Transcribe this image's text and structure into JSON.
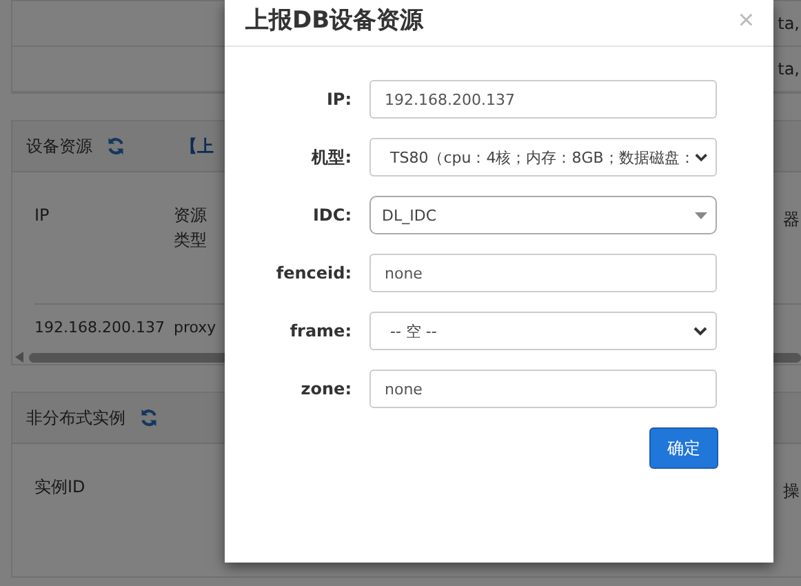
{
  "page": {
    "top_panel": {
      "side_texts": [
        "ta,",
        "ta,"
      ]
    },
    "device_panel": {
      "title": "设备资源",
      "link": "【上",
      "columns": [
        "IP",
        "资源类型"
      ],
      "side_text": "器",
      "rows": [
        [
          "192.168.200.137",
          "proxy"
        ]
      ]
    },
    "instance_panel": {
      "title": "非分布式实例",
      "columns": [
        "实例ID"
      ],
      "side_text": "操"
    }
  },
  "dialog": {
    "title": "上报DB设备资源",
    "close": "×",
    "fields": [
      {
        "label": "IP:",
        "kind": "input",
        "value": "192.168.200.137"
      },
      {
        "label": "机型:",
        "kind": "select",
        "value": "TS80（cpu：4核；内存：8GB；数据磁盘："
      },
      {
        "label": "IDC:",
        "kind": "combo",
        "value": "DL_IDC"
      },
      {
        "label": "fenceid:",
        "kind": "input",
        "value": "none"
      },
      {
        "label": "frame:",
        "kind": "select",
        "value": "-- 空 --"
      },
      {
        "label": "zone:",
        "kind": "input",
        "value": "none"
      }
    ],
    "buttons": [
      "确定"
    ]
  }
}
